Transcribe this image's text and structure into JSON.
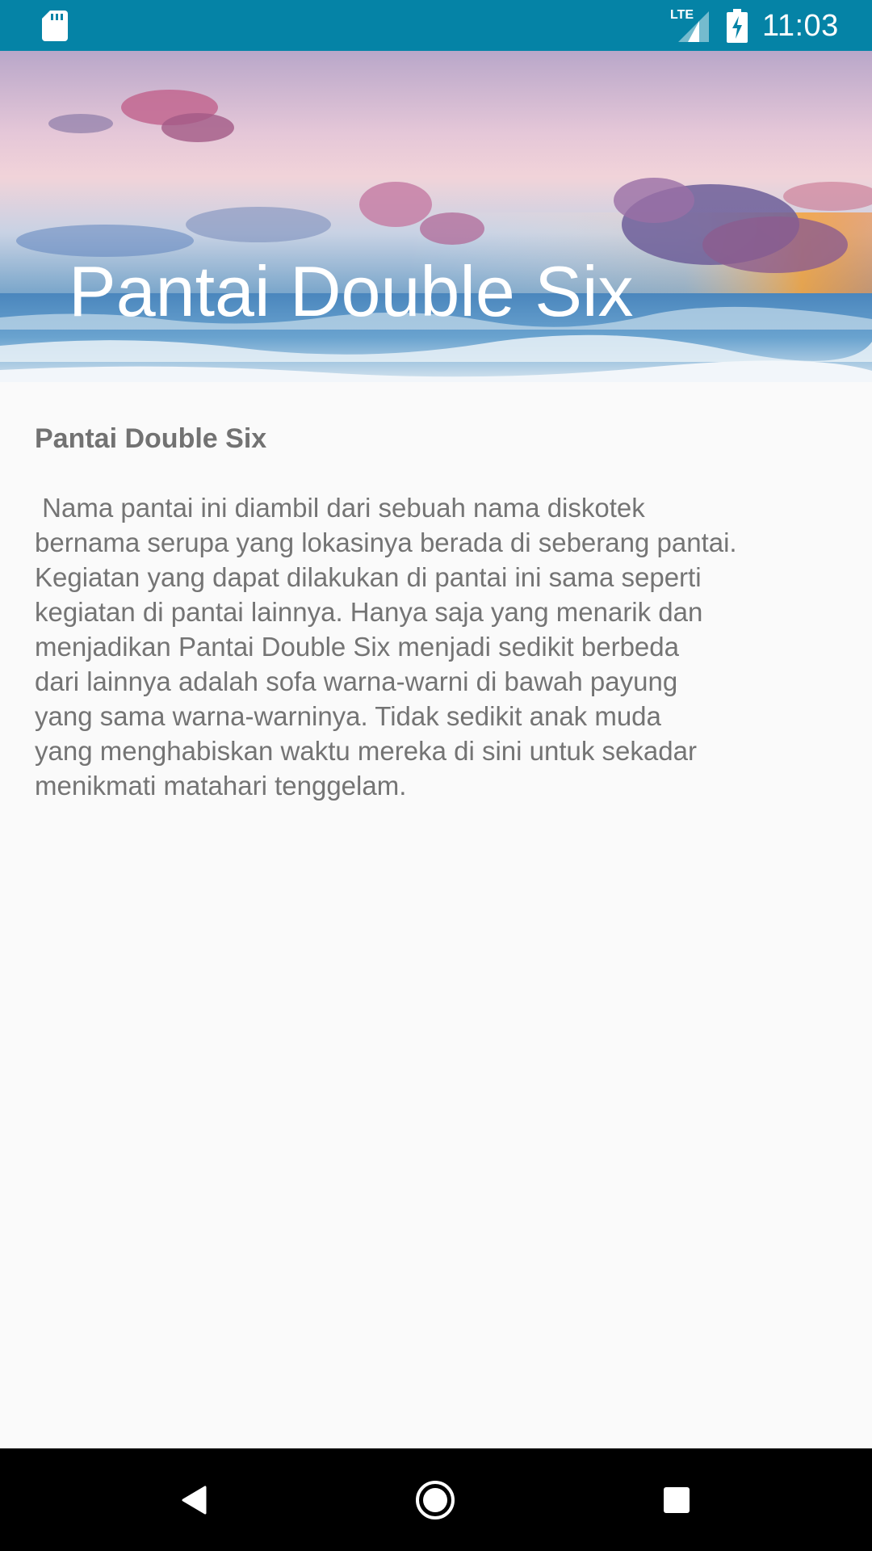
{
  "status_bar": {
    "time": "11:03",
    "network_label": "LTE",
    "icons": [
      "sd-card-icon",
      "lte-signal-icon",
      "battery-charging-icon"
    ],
    "background_color": "#0583a6"
  },
  "header": {
    "title": "Pantai Double Six",
    "image": "beach-sunset-image"
  },
  "content": {
    "title": "Pantai Double Six",
    "body": " Nama pantai ini diambil dari sebuah nama diskotek\nbernama serupa yang lokasinya berada di seberang pantai.\nKegiatan yang dapat dilakukan di pantai ini sama seperti\nkegiatan di pantai lainnya. Hanya saja yang menarik dan\nmenjadikan Pantai Double Six menjadi sedikit berbeda\ndari lainnya adalah sofa warna-warni di bawah payung\nyang sama warna-warninya. Tidak sedikit anak muda\nyang menghabiskan waktu mereka di sini untuk sekadar\nmenikmati matahari tenggelam."
  },
  "nav_bar": {
    "buttons": [
      "back-icon",
      "home-icon",
      "recents-icon"
    ]
  }
}
